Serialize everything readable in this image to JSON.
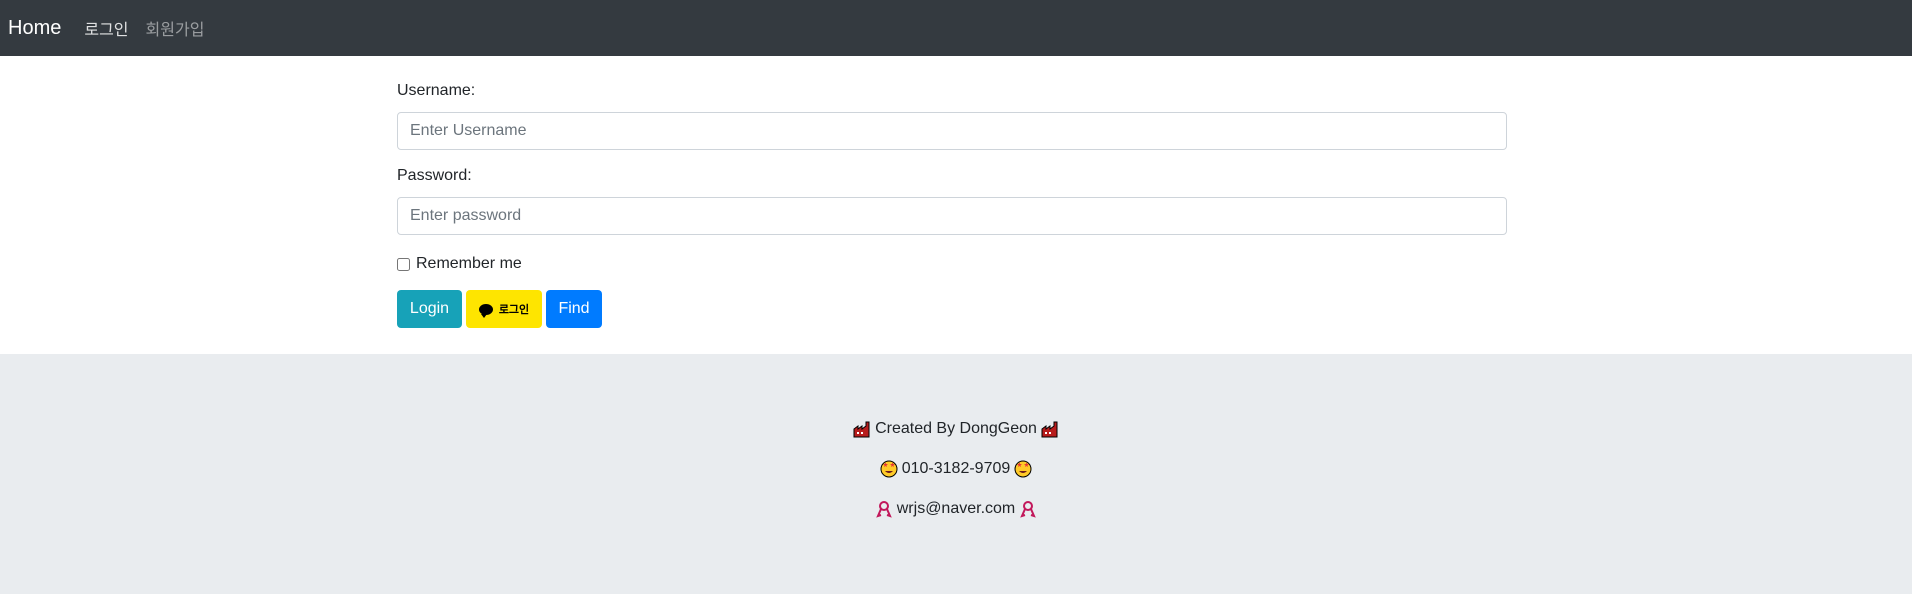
{
  "navbar": {
    "brand": "Home",
    "links": [
      {
        "label": "로그인"
      },
      {
        "label": "회원가입"
      }
    ]
  },
  "form": {
    "username_label": "Username:",
    "username_placeholder": "Enter Username",
    "username_value": "",
    "password_label": "Password:",
    "password_placeholder": "Enter password",
    "password_value": "",
    "remember_label": "Remember me",
    "remember_checked": false,
    "buttons": {
      "login": "Login",
      "kakao": "로그인",
      "find": "Find"
    }
  },
  "footer": {
    "created_by": "Created By DongGeon",
    "phone": "010-3182-9709",
    "email": "wrjs@naver.com",
    "icons": {
      "created_by": "factory-icon",
      "phone": "star-struck-face-icon",
      "email": "ribbon-icon"
    }
  },
  "colors": {
    "navbar_bg": "#343a40",
    "footer_bg": "#e9ecef",
    "login_btn": "#17a2b8",
    "kakao_btn": "#fee500",
    "find_btn": "#007bff"
  }
}
